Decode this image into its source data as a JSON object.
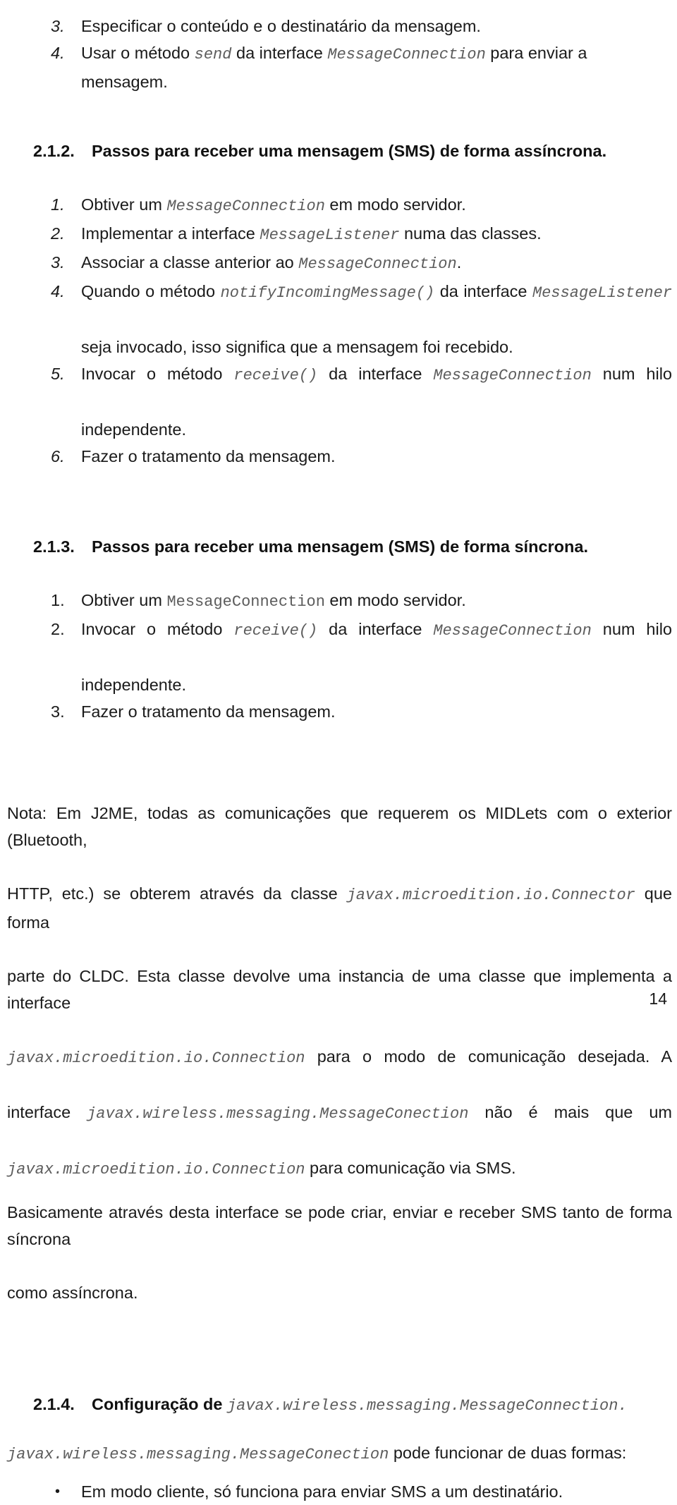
{
  "document": {
    "page_number": "14",
    "language": "pt",
    "code_color": "#5c5c5c",
    "text_color": "#1a1a1a"
  },
  "top_list": {
    "items": [
      {
        "num": "3.",
        "parts": [
          {
            "type": "text",
            "value": "Especificar o conteúdo e o destinatário da mensagem."
          }
        ]
      },
      {
        "num": "4.",
        "parts": [
          {
            "type": "text",
            "value": "Usar o método "
          },
          {
            "type": "code",
            "value": "send"
          },
          {
            "type": "text",
            "value": " da interface "
          },
          {
            "type": "code",
            "value": "MessageConnection"
          },
          {
            "type": "text",
            "value": " para enviar a mensagem."
          }
        ]
      }
    ]
  },
  "section_212": {
    "number": "2.1.2.",
    "title": "Passos para receber uma mensagem (SMS) de forma assíncrona.",
    "items": [
      {
        "num": "1.",
        "text_a": "Obtiver um ",
        "code_a": "MessageConnection",
        "text_b": " em modo servidor."
      },
      {
        "num": "2.",
        "text_a": "Implementar a interface ",
        "code_a": "MessageListener",
        "text_b": " numa das classes."
      },
      {
        "num": "3.",
        "text_a": "Associar a classe anterior ao ",
        "code_a": "MessageConnection",
        "text_b": "."
      },
      {
        "num": "4.",
        "line1_a": "Quando o método ",
        "line1_code": "notifyIncomingMessage()",
        "line1_b": " da interface ",
        "line1_code2": "MessageListener",
        "line2": "seja invocado, isso significa que a mensagem foi recebido."
      },
      {
        "num": "5.",
        "line1_a": "Invocar o método ",
        "line1_code": "receive()",
        "line1_b": " da interface ",
        "line1_code2": "MessageConnection",
        "line1_c": " num hilo",
        "line2": "independente."
      },
      {
        "num": "6.",
        "text_a": "Fazer o tratamento da mensagem.",
        "code_a": "",
        "text_b": ""
      }
    ]
  },
  "section_213": {
    "number": "2.1.3.",
    "title": "Passos para receber uma mensagem (SMS) de forma síncrona.",
    "items": [
      {
        "num": "1.",
        "text_a": "Obtiver um ",
        "code_a": "MessageConnection",
        "text_b": " em modo servidor."
      },
      {
        "num": "2.",
        "line1_a": "Invocar o método ",
        "line1_code": "receive()",
        "line1_b": " da interface ",
        "line1_code2": "MessageConnection",
        "line1_c": " num hilo",
        "line2": "independente."
      },
      {
        "num": "3.",
        "text_a": "Fazer o tratamento da mensagem.",
        "code_a": "",
        "text_b": ""
      }
    ]
  },
  "note_paragraph": {
    "line1": "Nota: Em J2ME, todas as comunicações que requerem os MIDLets com o exterior (Bluetooth,",
    "line2_a": "HTTP, etc.) se obterem através da classe ",
    "line2_code": "javax.microedition.io.Connector",
    "line2_b": " que forma",
    "line3": "parte do CLDC. Esta classe devolve uma instancia de uma classe que implementa a interface",
    "line4_code": "javax.microedition.io.Connection",
    "line4_b": " para o modo de comunicação desejada. A",
    "line5_a": "interface ",
    "line5_code": "javax.wireless.messaging.MessageConection",
    "line5_b": " não é mais que um",
    "line6_code": "javax.microedition.io.Connection",
    "line6_b": " para comunicação via SMS."
  },
  "basic_paragraph": {
    "line1": "Basicamente através desta interface se pode criar, enviar e receber SMS tanto de forma síncrona",
    "line2": "como assíncrona."
  },
  "section_214": {
    "number": "2.1.4.",
    "title_bold": "Configuração de ",
    "title_code": "javax.wireless.messaging.MessageConnection.",
    "intro_code": "javax.wireless.messaging.MessageConection",
    "intro_text": " pode funcionar de duas formas:",
    "bullets": [
      {
        "bullet": "•",
        "text": "Em modo cliente, só funciona para enviar SMS a um destinatário."
      }
    ]
  }
}
